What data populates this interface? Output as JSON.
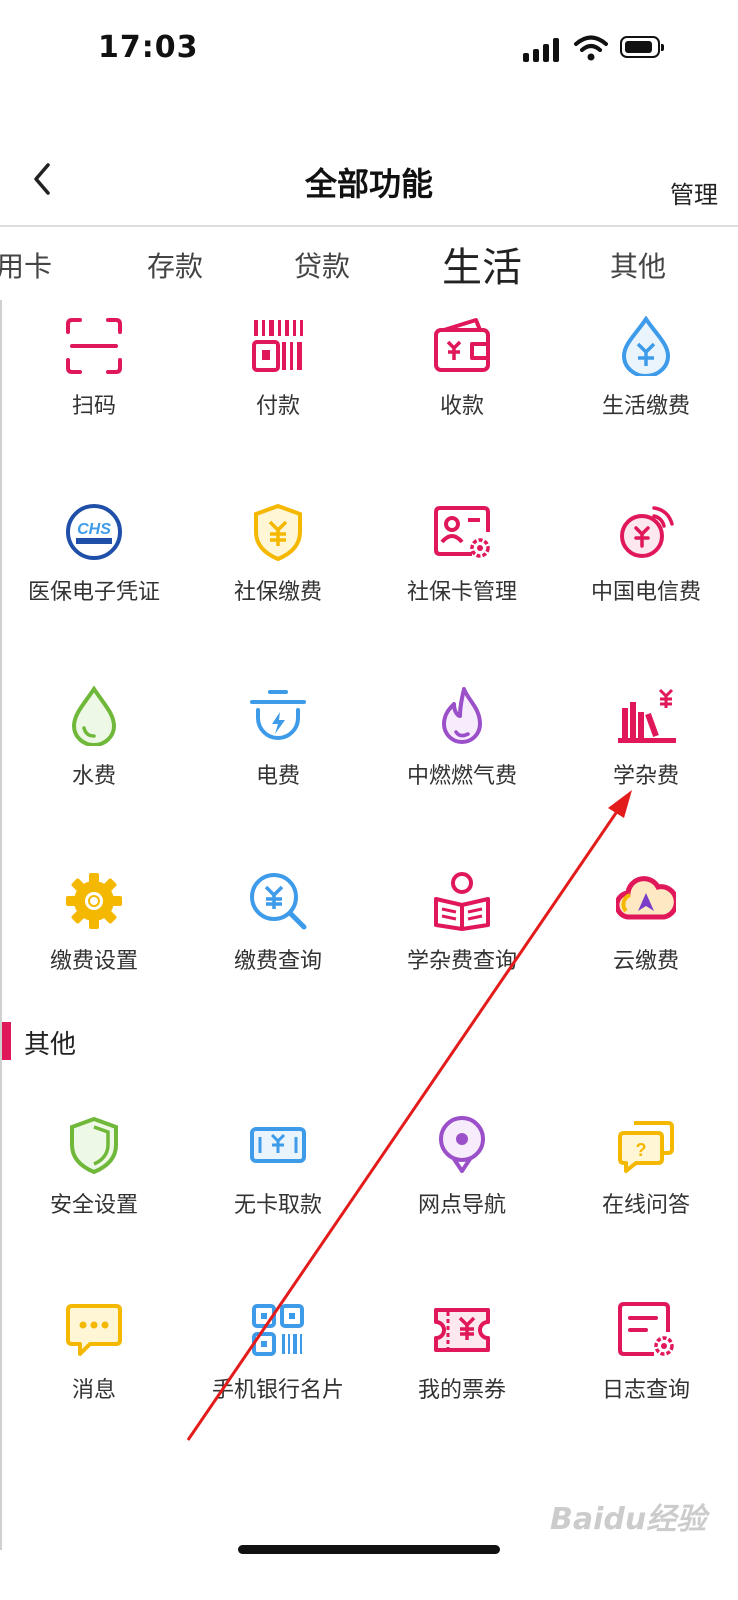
{
  "status_bar": {
    "time": "17:03"
  },
  "header": {
    "title": "全部功能",
    "manage_label": "管理"
  },
  "tabs": [
    {
      "label": "用卡"
    },
    {
      "label": "存款"
    },
    {
      "label": "贷款"
    },
    {
      "label": "生活",
      "active": true
    },
    {
      "label": "其他"
    }
  ],
  "life_items": [
    {
      "label": "扫码",
      "icon": "scan-icon"
    },
    {
      "label": "付款",
      "icon": "payment-code-icon"
    },
    {
      "label": "收款",
      "icon": "wallet-icon"
    },
    {
      "label": "生活缴费",
      "icon": "water-drop-yuan-icon"
    },
    {
      "label": "医保电子凭证",
      "icon": "chs-logo-icon"
    },
    {
      "label": "社保缴费",
      "icon": "shield-yuan-icon"
    },
    {
      "label": "社保卡管理",
      "icon": "id-card-gear-icon"
    },
    {
      "label": "中国电信费",
      "icon": "signal-yuan-icon"
    },
    {
      "label": "水费",
      "icon": "water-drop-icon"
    },
    {
      "label": "电费",
      "icon": "electric-pot-icon"
    },
    {
      "label": "中燃燃气费",
      "icon": "flame-icon"
    },
    {
      "label": "学杂费",
      "icon": "books-yuan-icon"
    },
    {
      "label": "缴费设置",
      "icon": "gear-icon"
    },
    {
      "label": "缴费查询",
      "icon": "search-yuan-icon"
    },
    {
      "label": "学杂费查询",
      "icon": "reading-person-icon"
    },
    {
      "label": "云缴费",
      "icon": "cloud-arrow-icon"
    }
  ],
  "other_section": {
    "title": "其他",
    "items": [
      {
        "label": "安全设置",
        "icon": "shield-icon"
      },
      {
        "label": "无卡取款",
        "icon": "cash-icon"
      },
      {
        "label": "网点导航",
        "icon": "location-pin-icon"
      },
      {
        "label": "在线问答",
        "icon": "chat-question-icon"
      },
      {
        "label": "消息",
        "icon": "message-icon"
      },
      {
        "label": "手机银行名片",
        "icon": "qr-code-icon"
      },
      {
        "label": "我的票券",
        "icon": "ticket-icon"
      },
      {
        "label": "日志查询",
        "icon": "log-gear-icon"
      }
    ]
  },
  "watermark": "Baidu经验",
  "colors": {
    "accent": "#e0185a",
    "arrow": "#e31b1b"
  }
}
